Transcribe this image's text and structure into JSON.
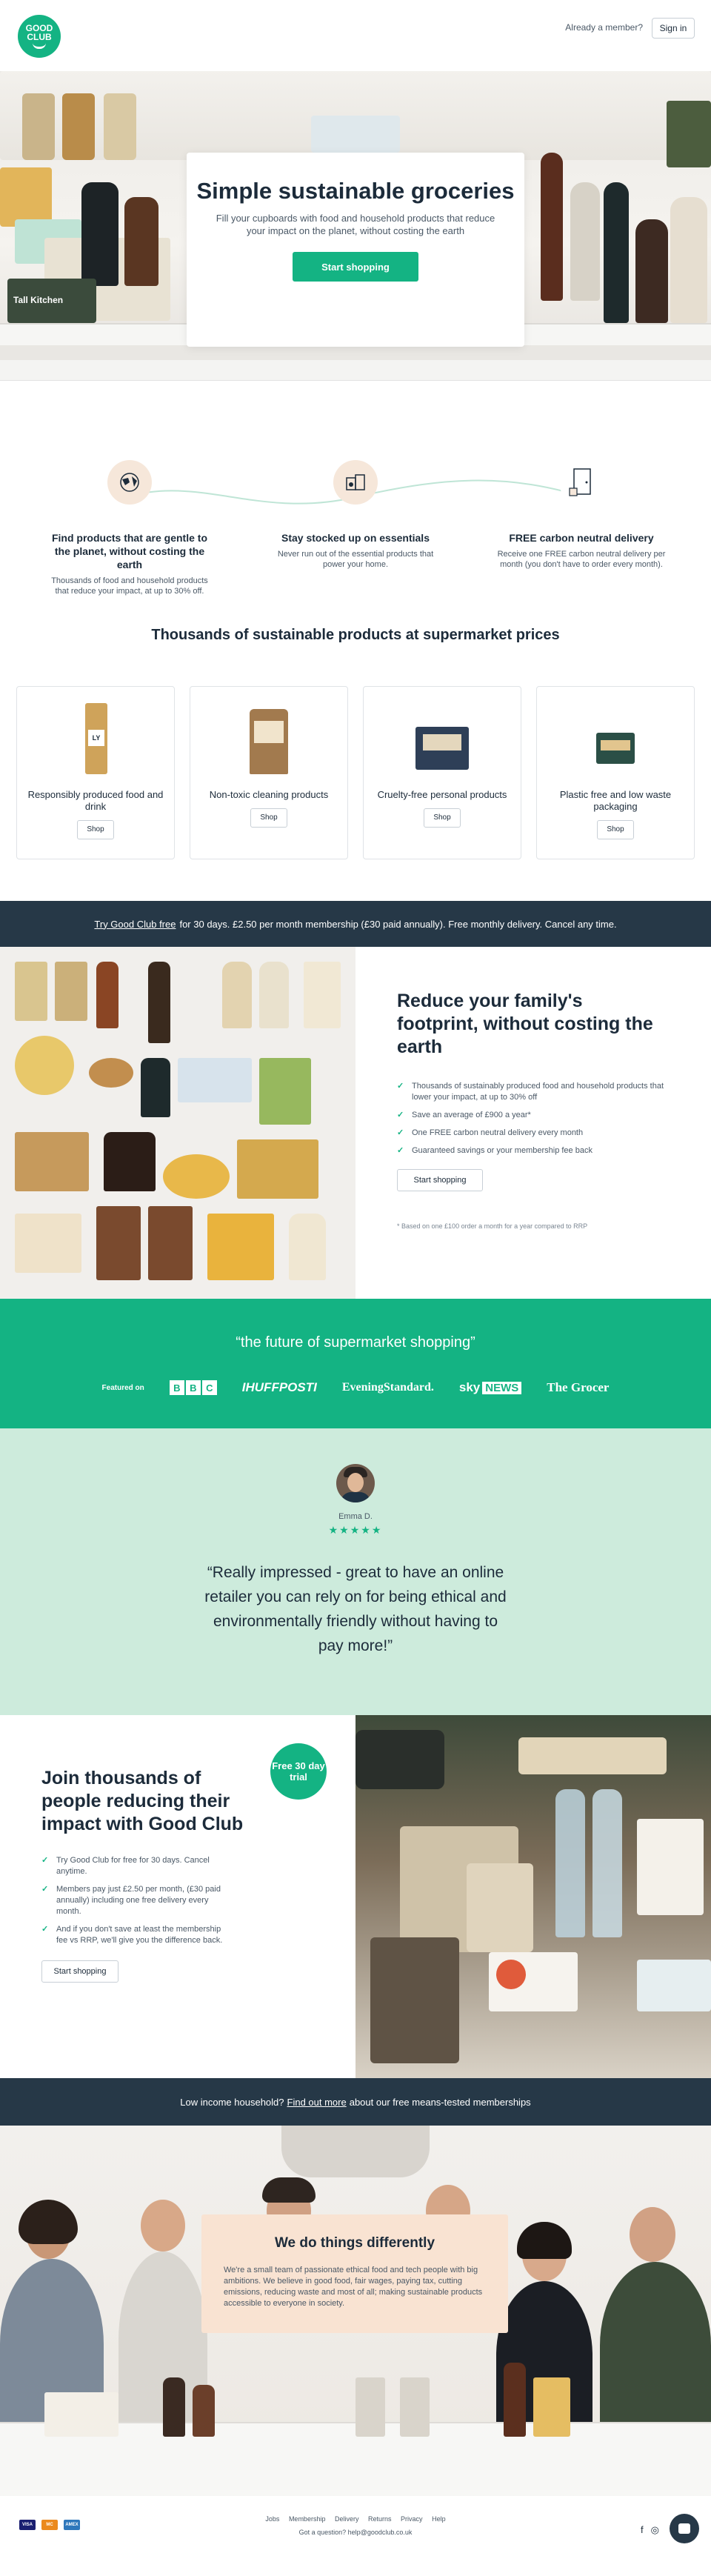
{
  "header": {
    "logo_line1": "GOOD",
    "logo_line2": "CLUB",
    "member_prompt": "Already a member?",
    "signin_label": "Sign in"
  },
  "hero": {
    "title": "Simple sustainable groceries",
    "subtitle": "Fill your cupboards with food and household products that reduce your impact on the planet, without costing the earth",
    "cta": "Start shopping",
    "tin_label": "Tall Kitchen"
  },
  "features": [
    {
      "title": "Find products that are gentle to the planet, without costing the earth",
      "text": "Thousands of food and household products that reduce your impact, at up to 30% off.",
      "icon": "globe-icon"
    },
    {
      "title": "Stay stocked up on essentials",
      "text": "Never run out of the essential products that power your home.",
      "icon": "boxes-icon"
    },
    {
      "title": "FREE carbon neutral delivery",
      "text": "Receive one FREE carbon neutral delivery per month (you don't have to order every month).",
      "icon": "door-icon"
    }
  ],
  "products": {
    "heading": "Thousands of sustainable products at supermarket prices",
    "cards": [
      {
        "label": "Responsibly produced food and drink",
        "shop": "Shop"
      },
      {
        "label": "Non-toxic cleaning products",
        "shop": "Shop"
      },
      {
        "label": "Cruelty-free personal products",
        "shop": "Shop"
      },
      {
        "label": "Plastic free and low waste packaging",
        "shop": "Shop"
      }
    ]
  },
  "trial_banner": {
    "link": "Try Good Club free",
    "text": "for 30 days. £2.50 per month membership (£30 paid annually). Free monthly delivery. Cancel any time."
  },
  "reduce": {
    "title": "Reduce your family's footprint, without costing the earth",
    "points": [
      "Thousands of sustainably produced food and household products that lower your impact, at up to 30% off",
      "Save an average of £900 a year*",
      "One FREE carbon neutral delivery every month",
      "Guaranteed savings or your membership fee back"
    ],
    "cta": "Start shopping",
    "footnote": "* Based on one £100 order a month for a year compared to RRP"
  },
  "press": {
    "quote": "“the future of supermarket shopping”",
    "featured_on": "Featured on",
    "outlets": [
      "B",
      "B",
      "C",
      "IHUFFPOSTI",
      "EveningStandard.",
      "sky",
      "NEWS",
      "The Grocer"
    ]
  },
  "testimonial": {
    "name": "Emma D.",
    "stars": "★★★★★",
    "quote": "“Really impressed - great to have an online retailer you can rely on for being ethical and environmentally friendly without having to pay more!”"
  },
  "join": {
    "title": "Join thousands of people reducing their impact with Good Club",
    "badge": "Free 30 day trial",
    "points": [
      "Try Good Club for free for 30 days. Cancel anytime.",
      "Members pay just £2.50 per month, (£30 paid annually) including one free delivery every month.",
      "And if you don't save at least the membership fee vs RRP, we'll give you the difference back."
    ],
    "cta": "Start shopping"
  },
  "income_banner": {
    "prefix": "Low income household?",
    "link": "Find out more",
    "suffix": "about our free means-tested memberships"
  },
  "team": {
    "title": "We do things differently",
    "text": "We're a small team of passionate ethical food and tech people with big ambitions. We believe in good food, fair wages, paying tax, cutting emissions, reducing waste and most of all; making sustainable products accessible to everyone in society."
  },
  "footer": {
    "links": [
      "Jobs",
      "Membership",
      "Delivery",
      "Returns",
      "Privacy",
      "Help"
    ],
    "contact": "Got a question? help@goodclub.co.uk",
    "payments": [
      "VISA",
      "MC",
      "AMEX"
    ],
    "social": [
      "f",
      "◎"
    ]
  },
  "colors": {
    "brand_green": "#14b383",
    "navy": "#263847",
    "mint": "#cdebdc",
    "peach": "#f9e3d2"
  }
}
